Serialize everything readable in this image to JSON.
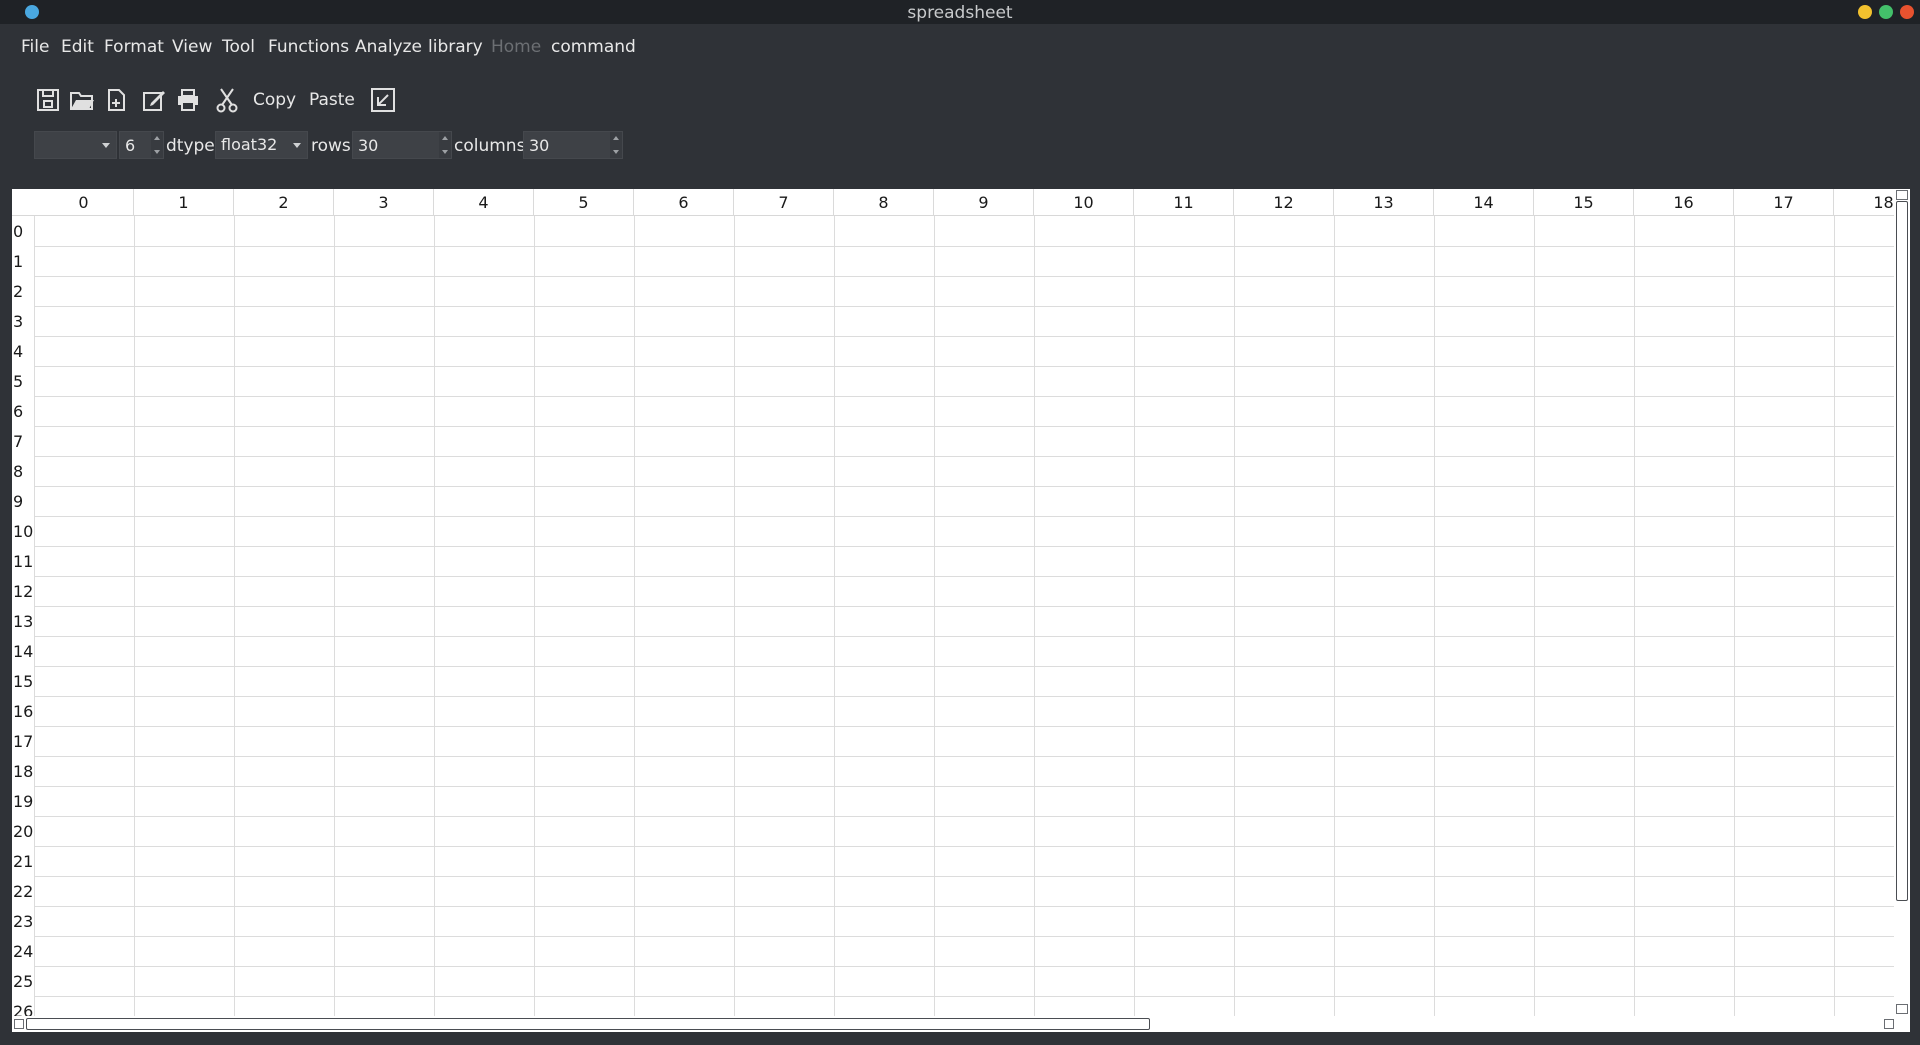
{
  "window": {
    "title": "spreadsheet"
  },
  "menu": {
    "file": "File",
    "edit": "Edit",
    "format": "Format",
    "view": "View",
    "tool": "Tool",
    "functions": "Functions",
    "analyze": "Analyze",
    "library": "library",
    "home": "Home",
    "command": "command"
  },
  "toolbar": {
    "copy_label": "Copy",
    "paste_label": "Paste",
    "icons": [
      "save-icon",
      "open-folder-icon",
      "new-file-icon",
      "edit-icon",
      "print-icon",
      "cut-icon",
      "export-icon"
    ]
  },
  "options": {
    "font_combo_value": "",
    "precision_value": "6",
    "dtype_label": "dtype:",
    "dtype_value": "float32",
    "rows_label": "rows:",
    "rows_value": "30",
    "columns_label": "columns:",
    "columns_value": "30"
  },
  "sheet": {
    "column_headers": [
      "0",
      "1",
      "2",
      "3",
      "4",
      "5",
      "6",
      "7",
      "8",
      "9",
      "10",
      "11",
      "12",
      "13",
      "14",
      "15",
      "16",
      "17",
      "18"
    ],
    "row_headers": [
      "0",
      "1",
      "2",
      "3",
      "4",
      "5",
      "6",
      "7",
      "8",
      "9",
      "10",
      "11",
      "12",
      "13",
      "14",
      "15",
      "16",
      "17",
      "18",
      "19",
      "20",
      "21",
      "22",
      "23",
      "24",
      "25",
      "26"
    ]
  },
  "colors": {
    "window_bg": "#2f3237",
    "titlebar_bg": "#1f2226",
    "sheet_bg": "#ffffff",
    "gridline": "#dcdcdc",
    "min_button": "#f2c12e",
    "max_button": "#43c06a",
    "close_button": "#e8522f",
    "app_icon": "#4aa8e0"
  }
}
